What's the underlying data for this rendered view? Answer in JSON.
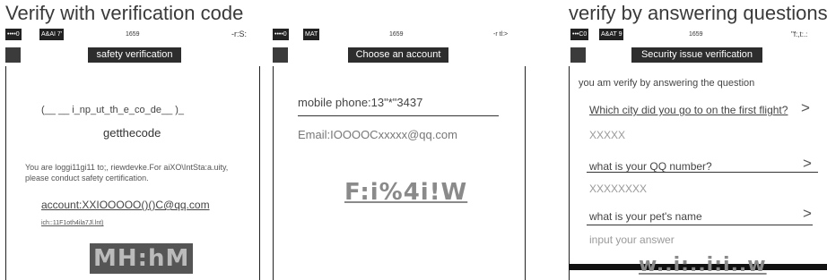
{
  "headings": {
    "left": "Verify with verification code",
    "right": "verify by answering questions"
  },
  "screens": [
    {
      "status": {
        "signal": "••••0",
        "carrier": "A&AI  7'",
        "time": "1659",
        "right": "-r:S:"
      },
      "nav_title": "safety verification",
      "code_input_label": "(__  __     i_np_ut_th_e_co_de__           )_",
      "get_code": "getthecode",
      "notice_line1": "You are loggi11gi11 to;, riewdevke.For aiXO\\IntSta:a.uity,",
      "notice_line2": "please conduct safety certification.",
      "account": "account:XXIOOOOO()()C@qq.com",
      "small_link": "ich::11F1oth4ila7Jl.lnt)",
      "captcha": "MH:hM"
    },
    {
      "status": {
        "signal": "••••0",
        "carrier": "MAT",
        "time": "1659",
        "right": "-r tl:>"
      },
      "nav_title": "Choose an account",
      "mobile": "mobile phone:13\"*\"3437",
      "email": "Email:IOOOOCxxxxx@qq.com",
      "captcha": "F:i%4i!W"
    },
    {
      "status": {
        "signal": "•••C0",
        "carrier": "A&AT  9",
        "time": "1659",
        "right": "\"f:,t:.:"
      },
      "nav_title": "Security issue verification",
      "intro": "you am  verify by answering the question",
      "questions": [
        {
          "question": "Which city did you go to on the first flight?",
          "answer": "XXXXX",
          "chevron": ">"
        },
        {
          "question": "what is your QQ number?",
          "answer": "XXXXXXXX",
          "chevron": ">"
        },
        {
          "question": "what is your pet's name",
          "placeholder": "input your answer",
          "chevron": ">"
        }
      ],
      "captcha": "w..i:..i:i..w"
    }
  ]
}
